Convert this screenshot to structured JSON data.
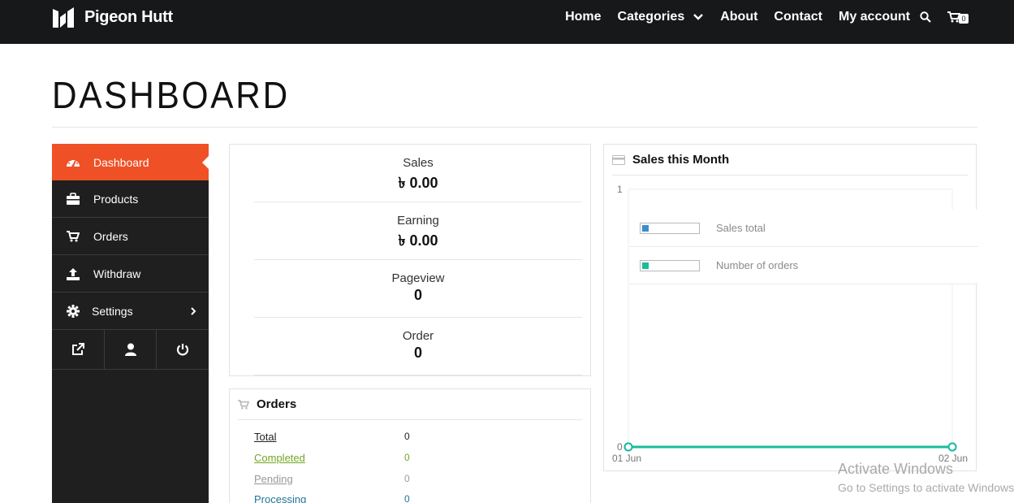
{
  "brand": {
    "name": "Pigeon Hutt",
    "logo_icon": "brand-logo-icon"
  },
  "nav": {
    "home": "Home",
    "categories": "Categories",
    "about": "About",
    "contact": "Contact",
    "my_account": "My account",
    "cart_count": "0"
  },
  "page": {
    "title": "DASHBOARD"
  },
  "sidebar": {
    "accent_color": "#f05025",
    "items": [
      {
        "label": "Dashboard",
        "icon": "dashboard-icon",
        "active": true
      },
      {
        "label": "Products",
        "icon": "briefcase-icon"
      },
      {
        "label": "Orders",
        "icon": "cart-icon"
      },
      {
        "label": "Withdraw",
        "icon": "upload-icon"
      },
      {
        "label": "Settings",
        "icon": "gear-icon"
      }
    ],
    "tools": [
      "external-link-icon",
      "user-icon",
      "power-icon"
    ]
  },
  "stats": [
    {
      "label": "Sales",
      "value": "৳ 0.00"
    },
    {
      "label": "Earning",
      "value": "৳ 0.00"
    },
    {
      "label": "Pageview",
      "value": "0"
    },
    {
      "label": "Order",
      "value": "0"
    }
  ],
  "orders": {
    "title": "Orders",
    "rows": [
      {
        "label": "Total",
        "value": "0",
        "color": "#222222"
      },
      {
        "label": "Completed",
        "value": "0",
        "color": "#73a724"
      },
      {
        "label": "Pending",
        "value": "0",
        "color": "#999999"
      },
      {
        "label": "Processing",
        "value": "0",
        "color": "#21759b"
      }
    ]
  },
  "sales_chart": {
    "title": "Sales this Month",
    "legend": [
      {
        "label": "Sales total",
        "color": "#3c8dcc"
      },
      {
        "label": "Number of orders",
        "color": "#1abc9c"
      }
    ]
  },
  "chart_data": {
    "type": "line",
    "x": [
      "01 Jun",
      "02 Jun"
    ],
    "ylim": [
      0,
      1
    ],
    "y_ticks": [
      "0",
      "1"
    ],
    "series": [
      {
        "name": "Sales total",
        "values": [
          0,
          0
        ]
      },
      {
        "name": "Number of orders",
        "values": [
          0,
          0
        ]
      }
    ]
  },
  "watermark": {
    "line1": "Activate Windows",
    "line2": "Go to Settings to activate Windows."
  }
}
